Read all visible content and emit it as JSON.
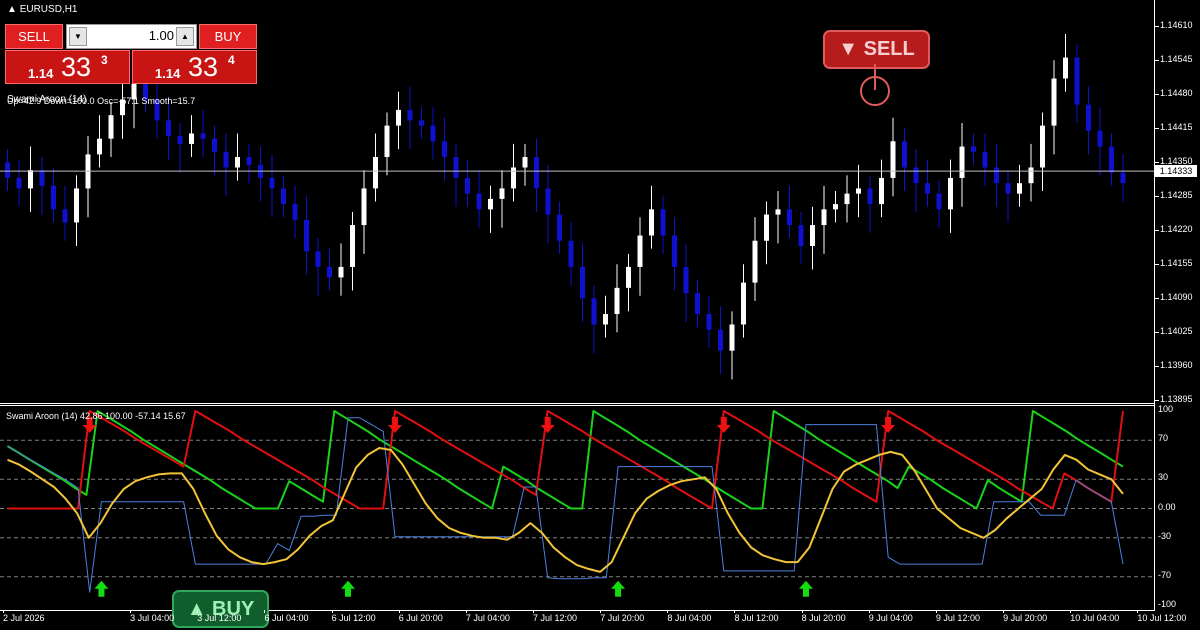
{
  "symbol": "EURUSD,H1",
  "indicator_top": {
    "name": "Swami Aroon (14)",
    "values": "Up=42.9  Down=100.0  Osc=-57.1  Smooth=15.7"
  },
  "indicator_panel": {
    "label": "Swami Aroon (14) 42.86 100.00 -57.14 15.67"
  },
  "trade_panel": {
    "sell_label": "SELL",
    "buy_label": "BUY",
    "lot": "1.00",
    "sell_price": {
      "prefix": "1.14",
      "big": "33",
      "sup": "3"
    },
    "buy_price": {
      "prefix": "1.14",
      "big": "33",
      "sup": "4"
    }
  },
  "signals": {
    "sell": "▼ SELL",
    "buy": "▲ BUY"
  },
  "current_price": "1.14333",
  "price_axis": [
    "1.14610",
    "1.14545",
    "1.14480",
    "1.14415",
    "1.14350",
    "1.14285",
    "1.14220",
    "1.14155",
    "1.14090",
    "1.14025",
    "1.13960",
    "1.13895"
  ],
  "osc_axis": [
    "100",
    "70",
    "30",
    "0.00",
    "-30",
    "-70",
    "-100"
  ],
  "time_axis": [
    "2 Jul 2026",
    "3 Jul 04:00",
    "3 Jul 12:00",
    "6 Jul 04:00",
    "6 Jul 12:00",
    "6 Jul 20:00",
    "7 Jul 04:00",
    "7 Jul 12:00",
    "7 Jul 20:00",
    "8 Jul 04:00",
    "8 Jul 12:00",
    "8 Jul 20:00",
    "9 Jul 04:00",
    "9 Jul 12:00",
    "9 Jul 20:00",
    "10 Jul 04:00",
    "10 Jul 12:00"
  ],
  "colors": {
    "bull": "#ffffff",
    "bear": "#1010d0",
    "aroon_up": "#19d219",
    "aroon_down": "#e01010",
    "osc": "#4d7fe0",
    "smooth": "#f2c437",
    "buy_arrow": "#11dd11",
    "sell_arrow": "#ee1111"
  },
  "chart_data": [
    {
      "type": "candlestick",
      "title": "EURUSD,H1",
      "ylim": [
        1.1389,
        1.1466
      ],
      "close": [
        1.1432,
        1.143,
        1.14335,
        1.14305,
        1.1426,
        1.14235,
        1.143,
        1.14365,
        1.14395,
        1.1444,
        1.1447,
        1.145,
        1.1447,
        1.1443,
        1.144,
        1.14385,
        1.14405,
        1.14395,
        1.1437,
        1.1434,
        1.1436,
        1.14345,
        1.1432,
        1.143,
        1.1427,
        1.1424,
        1.1418,
        1.1415,
        1.1413,
        1.1415,
        1.1423,
        1.143,
        1.1436,
        1.1442,
        1.1445,
        1.1443,
        1.1442,
        1.1439,
        1.1436,
        1.1432,
        1.1429,
        1.1426,
        1.1428,
        1.143,
        1.1434,
        1.1436,
        1.143,
        1.1425,
        1.142,
        1.1415,
        1.1409,
        1.1404,
        1.1406,
        1.1411,
        1.1415,
        1.1421,
        1.1426,
        1.1421,
        1.1415,
        1.141,
        1.1406,
        1.1403,
        1.1399,
        1.1404,
        1.1412,
        1.142,
        1.1425,
        1.1426,
        1.1423,
        1.1419,
        1.1423,
        1.1426,
        1.1427,
        1.1429,
        1.143,
        1.1427,
        1.1432,
        1.1439,
        1.1434,
        1.1431,
        1.1429,
        1.1426,
        1.1432,
        1.1438,
        1.1437,
        1.1434,
        1.1431,
        1.1429,
        1.1431,
        1.1434,
        1.1442,
        1.1451,
        1.1455,
        1.1446,
        1.1441,
        1.1438,
        1.1433,
        1.1431
      ]
    },
    {
      "type": "line",
      "title": "Swami Aroon (14) 42.86 100.00 -57.14 15.67",
      "ylim": [
        -100,
        100
      ],
      "series": [
        {
          "values": [
            64,
            57,
            50,
            43,
            36,
            29,
            21,
            14,
            100,
            93,
            86,
            79,
            71,
            64,
            57,
            50,
            43,
            36,
            29,
            21,
            14,
            7,
            0,
            0,
            0,
            28,
            21,
            14,
            7,
            100,
            93,
            86,
            79,
            71,
            64,
            57,
            50,
            43,
            36,
            29,
            21,
            14,
            7,
            0,
            43,
            36,
            29,
            21,
            14,
            7,
            0,
            0,
            100,
            93,
            86,
            79,
            71,
            64,
            57,
            50,
            43,
            36,
            29,
            21,
            14,
            7,
            0,
            0,
            100,
            93,
            86,
            79,
            71,
            64,
            57,
            50,
            43,
            36,
            29,
            21,
            43,
            36,
            29,
            21,
            14,
            7,
            0,
            29,
            21,
            14,
            7,
            100,
            93,
            86,
            79,
            71,
            64,
            57,
            50,
            43
          ]
        },
        {
          "values": [
            0,
            0,
            0,
            0,
            0,
            0,
            0,
            100,
            93,
            86,
            79,
            71,
            64,
            57,
            50,
            43,
            100,
            93,
            86,
            79,
            71,
            64,
            57,
            50,
            43,
            36,
            29,
            21,
            14,
            7,
            0,
            0,
            0,
            100,
            93,
            86,
            79,
            71,
            64,
            57,
            50,
            43,
            36,
            29,
            21,
            14,
            100,
            93,
            86,
            79,
            71,
            64,
            57,
            50,
            43,
            36,
            29,
            21,
            14,
            7,
            0,
            100,
            93,
            86,
            79,
            71,
            64,
            57,
            50,
            43,
            36,
            29,
            21,
            14,
            7,
            100,
            93,
            86,
            79,
            71,
            64,
            57,
            50,
            43,
            36,
            29,
            21,
            14,
            7,
            0,
            36,
            29,
            21,
            14,
            7,
            100
          ]
        },
        {
          "values": [
            64,
            57,
            50,
            43,
            36,
            29,
            21,
            -86,
            7,
            7,
            7,
            7,
            7,
            7,
            7,
            7,
            -57,
            -57,
            -57,
            -57,
            -57,
            -57,
            -57,
            -36,
            -43,
            -8,
            -8,
            -7,
            -7,
            93,
            93,
            86,
            79,
            -29,
            -29,
            -29,
            -29,
            -29,
            -29,
            -29,
            -29,
            -29,
            -29,
            -29,
            22,
            22,
            -71,
            -72,
            -72,
            -72,
            -71,
            -71,
            43,
            43,
            43,
            43,
            43,
            43,
            43,
            43,
            43,
            -64,
            -64,
            -64,
            -64,
            -64,
            -64,
            -64,
            86,
            86,
            86,
            86,
            86,
            86,
            86,
            -50,
            -57,
            -57,
            -57,
            -57,
            -57,
            -57,
            -57,
            -57,
            7,
            7,
            7,
            7,
            -7,
            -7,
            -7,
            29,
            21,
            14,
            7,
            -57
          ]
        },
        {
          "values": [
            50,
            45,
            38,
            30,
            22,
            10,
            -5,
            -30,
            -15,
            5,
            20,
            28,
            32,
            35,
            36,
            36,
            20,
            -5,
            -28,
            -42,
            -50,
            -55,
            -57,
            -55,
            -52,
            -42,
            -28,
            -18,
            -12,
            15,
            42,
            55,
            62,
            60,
            45,
            25,
            5,
            -10,
            -20,
            -25,
            -28,
            -30,
            -30,
            -32,
            -25,
            -15,
            -25,
            -40,
            -50,
            -58,
            -62,
            -65,
            -55,
            -30,
            -5,
            10,
            18,
            24,
            28,
            30,
            32,
            20,
            -5,
            -25,
            -40,
            -48,
            -52,
            -55,
            -55,
            -40,
            -10,
            20,
            38,
            45,
            50,
            55,
            58,
            55,
            40,
            20,
            0,
            -10,
            -20,
            -25,
            -30,
            -22,
            -10,
            0,
            10,
            20,
            40,
            55,
            50,
            40,
            35,
            30,
            15
          ]
        }
      ]
    }
  ]
}
